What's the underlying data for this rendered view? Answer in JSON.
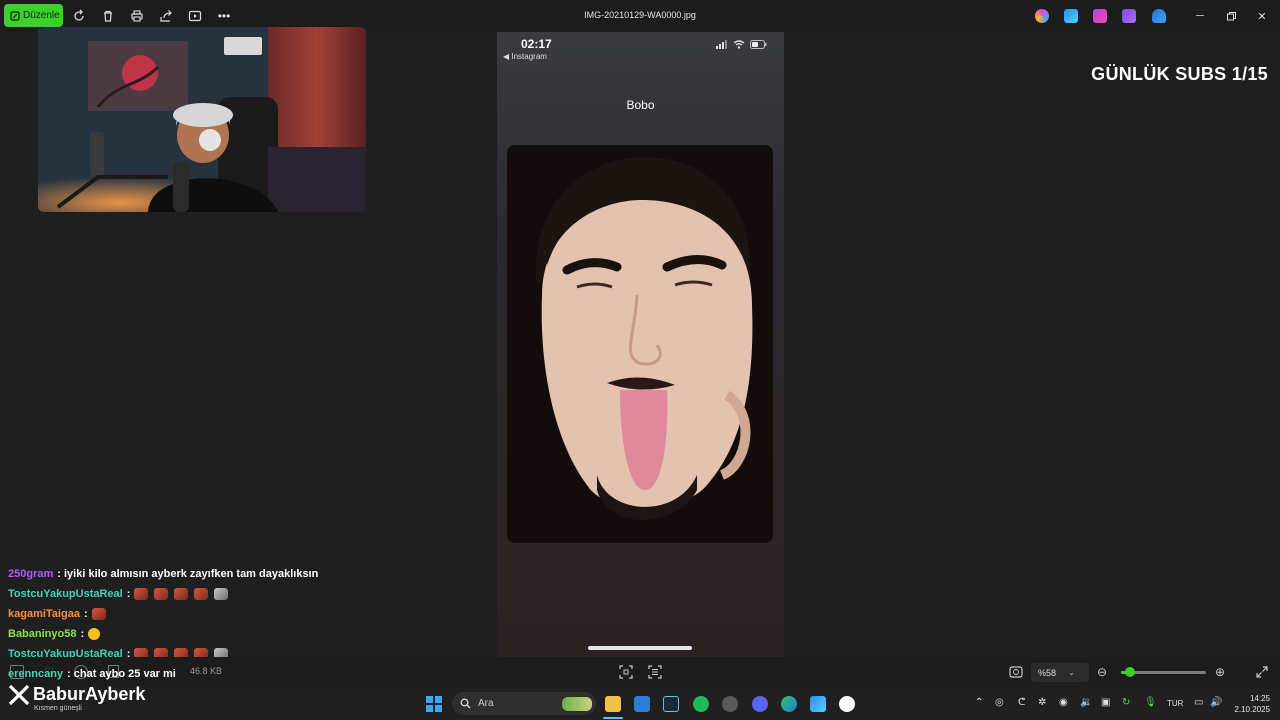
{
  "toolbar": {
    "edit_label": "Düzenle",
    "file_title": "IMG-20210129-WA0000.jpg",
    "icons": [
      "rotate-icon",
      "delete-icon",
      "print-icon",
      "share-icon",
      "slideshow-icon",
      "more-icon"
    ]
  },
  "overlay": {
    "subs_text": "GÜNLÜK SUBS 1/15"
  },
  "phone": {
    "time": "02:17",
    "back_label": "◀ Instagram",
    "chat_name": "Bobo"
  },
  "chat": [
    {
      "user": "250gram",
      "color": "#b05bff",
      "message": ": iyiki kilo almısın ayberk zayıfken tam dayaklıksın",
      "emotes": []
    },
    {
      "user": "TostcuYakupUstaReal",
      "color": "#43d4b4",
      "message": ":",
      "emotes": [
        "red",
        "red",
        "red",
        "red",
        "grey"
      ]
    },
    {
      "user": "kagamiTaigaa",
      "color": "#ff8f3a",
      "message": ":",
      "emotes": [
        "red"
      ]
    },
    {
      "user": "Babaninyo58",
      "color": "#8fe04a",
      "message": ":",
      "emotes": [
        "face"
      ]
    },
    {
      "user": "TostcuYakupUstaReal",
      "color": "#43d4b4",
      "message": ":",
      "emotes": [
        "red",
        "red",
        "red",
        "red",
        "grey"
      ]
    },
    {
      "user": "erenncany",
      "color": "#43d4b4",
      "message": ": chat aybo 25 var mi",
      "emotes": []
    }
  ],
  "statusbar": {
    "file_size": "46.8 KB",
    "zoom_label": "%58",
    "zoom_fraction": 0.11
  },
  "brand": {
    "name": "BaburAyberk",
    "sub": "Kısmen güneşli"
  },
  "taskbar": {
    "search_placeholder": "Ara",
    "language": "TUR",
    "time": "14:25",
    "date": "2.10.2025"
  }
}
